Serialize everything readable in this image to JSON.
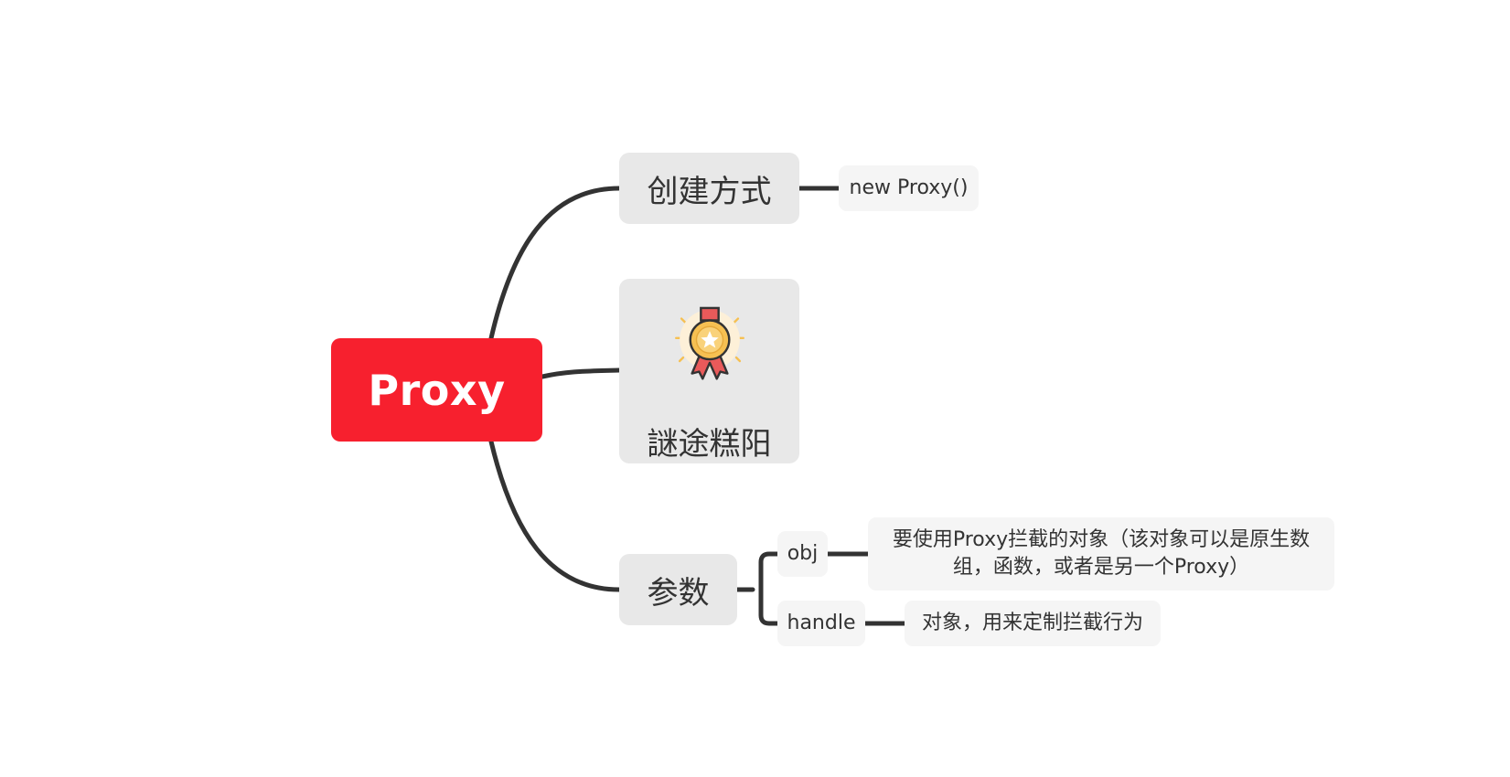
{
  "root": {
    "label": "Proxy"
  },
  "branches": [
    {
      "label": "创建方式",
      "children": [
        {
          "label": "new Proxy()"
        }
      ]
    },
    {
      "label": "謎途糕阳",
      "icon": "award-medal-icon"
    },
    {
      "label": "参数",
      "children": [
        {
          "label": "obj",
          "children": [
            {
              "label": "要使用Proxy拦截的对象（该对象可以是原生数\n组，函数，或者是另一个Proxy）"
            }
          ]
        },
        {
          "label": "handle",
          "children": [
            {
              "label": "对象，用来定制拦截行为"
            }
          ]
        }
      ]
    }
  ],
  "colors": {
    "root_fill": "#f7202e",
    "root_text": "#ffffff",
    "branch_fill": "#e8e8e8",
    "leaf_fill": "#f5f5f5",
    "connector": "#333333",
    "text": "#333333",
    "medal_gold": "#f6c052",
    "medal_ribbon": "#e95a5a"
  }
}
